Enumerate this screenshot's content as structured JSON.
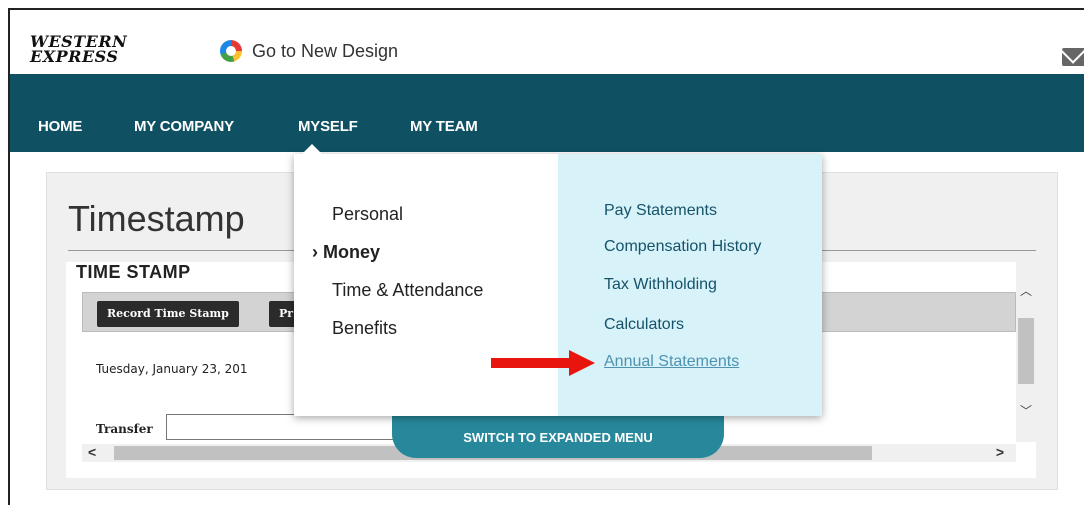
{
  "header": {
    "logo_line1": "WESTERN",
    "logo_line2": "EXPRESS",
    "new_design_label": "Go to New Design"
  },
  "nav": {
    "items": [
      {
        "label": "HOME"
      },
      {
        "label": "MY COMPANY"
      },
      {
        "label": "MYSELF"
      },
      {
        "label": "MY TEAM"
      }
    ]
  },
  "page": {
    "title": "Timestamp",
    "frame_title": "TIME STAMP",
    "record_button": "Record Time Stamp",
    "second_button": "Pr",
    "date_text": "Tuesday, January 23, 201",
    "transfer_label": "Transfer",
    "transfer_value": ""
  },
  "dropdown": {
    "left_items": [
      {
        "label": "Personal"
      },
      {
        "label": "Money",
        "marker": "›"
      },
      {
        "label": "Time & Attendance"
      },
      {
        "label": "Benefits"
      }
    ],
    "right_items": [
      {
        "label": "Pay Statements"
      },
      {
        "label": "Compensation History"
      },
      {
        "label": "Tax Withholding"
      },
      {
        "label": "Calculators"
      },
      {
        "label": "Annual Statements"
      }
    ],
    "switch_label": "SWITCH TO EXPANDED MENU"
  },
  "colors": {
    "nav_bg": "#0f5163",
    "submenu_bg": "#d7f2f8",
    "link": "#15536a",
    "switch_bg": "#27889b",
    "annotation_arrow": "#e8150e"
  },
  "icons": {
    "mail": "mail-icon",
    "new_design": "color-ring-icon"
  }
}
